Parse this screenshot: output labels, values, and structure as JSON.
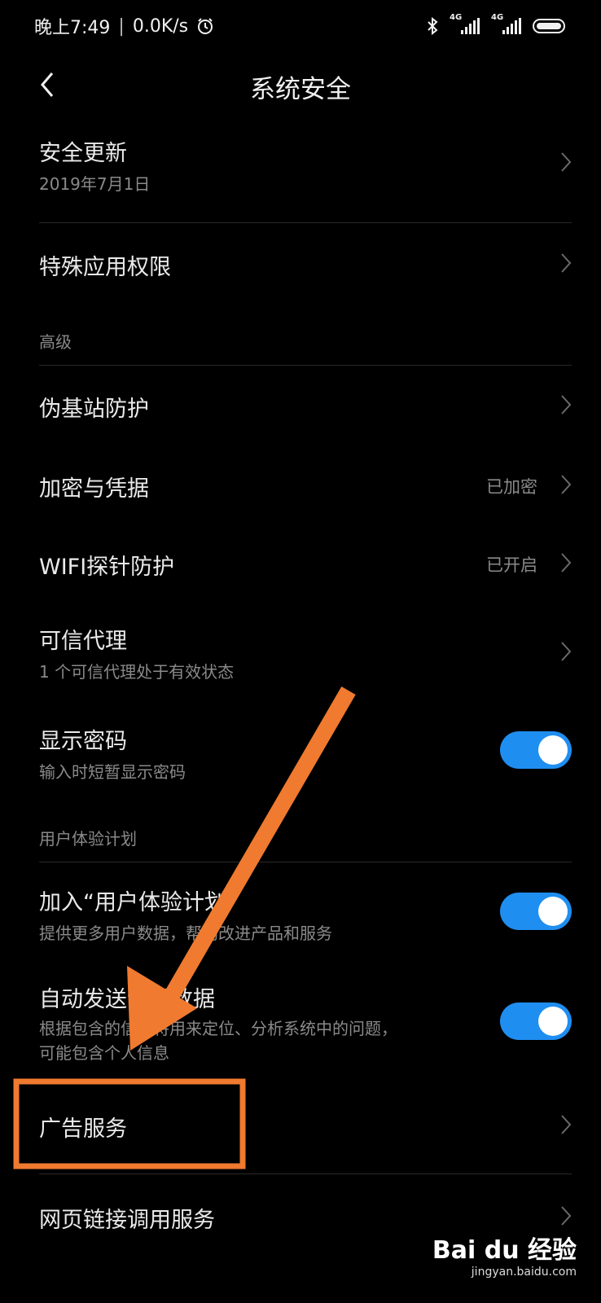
{
  "status_bar": {
    "time": "晚上7:49",
    "separator": "|",
    "speed": "0.0K/s",
    "network1": "4G",
    "network2": "4G"
  },
  "header": {
    "title": "系统安全"
  },
  "items": {
    "security_update": {
      "label": "安全更新",
      "sub": "2019年7月1日"
    },
    "special_permissions": {
      "label": "特殊应用权限"
    },
    "pseudo_base_station": {
      "label": "伪基站防护"
    },
    "encryption": {
      "label": "加密与凭据",
      "value": "已加密"
    },
    "wifi_probe": {
      "label": "WIFI探针防护",
      "value": "已开启"
    },
    "trust_agents": {
      "label": "可信代理",
      "sub": "1 个可信代理处于有效状态"
    },
    "show_passwords": {
      "label": "显示密码",
      "sub": "输入时短暂显示密码",
      "enabled": true
    },
    "join_ux": {
      "label": "加入“用户体验计划”",
      "sub": "提供更多用户数据，帮助改进产品和服务",
      "enabled": true
    },
    "auto_send": {
      "label": "自动发送诊断数据",
      "sub1": "根据包含的信息将用来定位、分析系统中的问题，",
      "sub2": "可能包含个人信息",
      "enabled": true
    },
    "ad_service": {
      "label": "广告服务"
    },
    "web_link": {
      "label": "网页链接调用服务"
    }
  },
  "sections": {
    "advanced": "高级",
    "ux_plan": "用户体验计划"
  },
  "watermark": {
    "brand": "Bai du 经验",
    "url": "jingyan.baidu.com"
  },
  "colors": {
    "toggle_on": "#1f8ef1",
    "annotation": "#f07a2f"
  }
}
